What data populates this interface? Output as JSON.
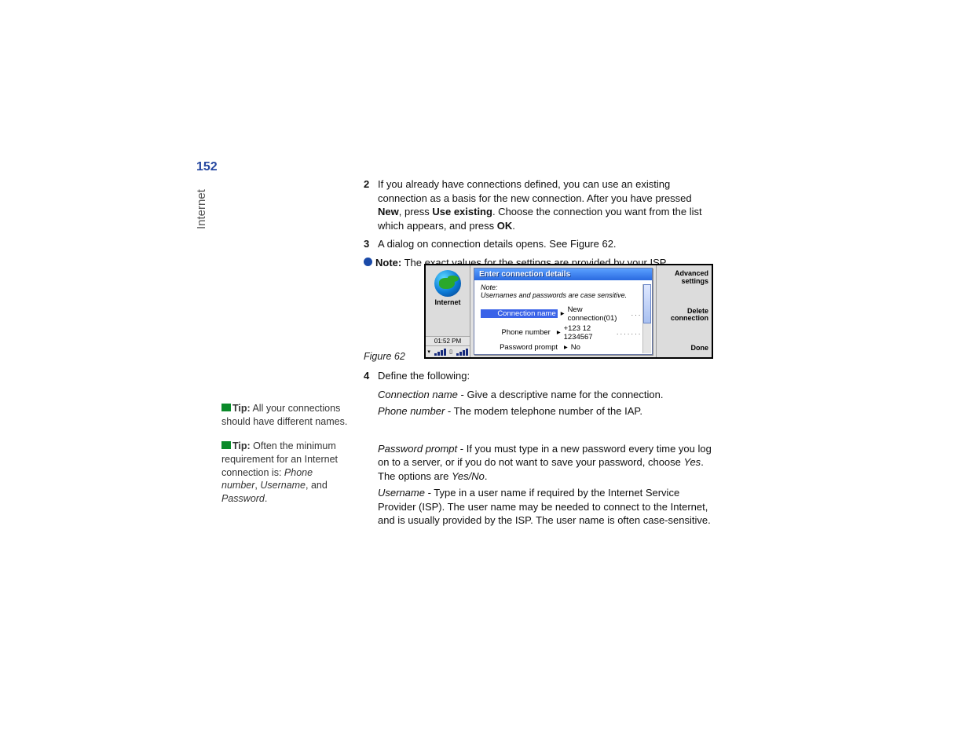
{
  "page_number": "152",
  "side_label": "Internet",
  "tips": [
    {
      "label": "Tip:",
      "text_before": " All your connections should have different names."
    },
    {
      "label": "Tip:",
      "text_before": " Often the minimum requirement for an Internet connection is: ",
      "em1": "Phone number",
      "sep1": ", ",
      "em2": "Username",
      "sep2": ", and ",
      "em3": "Password",
      "tail": "."
    }
  ],
  "steps": {
    "s2_num": "2",
    "s2_a": "If you already have connections defined, you can use an existing connection as a basis for the new connection. After you have pressed ",
    "s2_b": "New",
    "s2_c": ", press ",
    "s2_d": "Use existing",
    "s2_e": ". Choose the connection you want from the list which appears, and press ",
    "s2_f": "OK",
    "s2_g": ".",
    "s3_num": "3",
    "s3": "A dialog on connection details opens. See Figure 62.",
    "note_label": "Note:",
    "note_text": " The exact values for the settings are provided by your ISP.",
    "s4_num": "4",
    "s4": "Define the following:"
  },
  "fig_caption": "Figure 62",
  "shot": {
    "left_label": "Internet",
    "time": "01:52 PM",
    "dlg_title": "Enter connection details",
    "dlg_note1": "Note:",
    "dlg_note2": "Usernames and passwords are case sensitive.",
    "f1_label": "Connection name",
    "f1_val": "New connection(01)",
    "f2_label": "Phone number",
    "f2_val": "+123 12 1234567",
    "f3_label": "Password prompt",
    "f3_val": "No",
    "soft1a": "Advanced",
    "soft1b": "settings",
    "soft2a": "Delete",
    "soft2b": "connection",
    "soft3": "Done"
  },
  "defs": {
    "d1_t": "Connection name",
    "d1_b": " - Give a descriptive name for the connection.",
    "d2_t": "Phone number",
    "d2_b": " - The modem telephone number of the IAP.",
    "d3_t": "Password prompt",
    "d3_a": " - If you must type in a new password every time you log on to a server, or if you do not want to save your password, choose ",
    "d3_y": "Yes",
    "d3_b": ". The options are ",
    "d3_yn": "Yes/No",
    "d3_c": ".",
    "d4_t": "Username",
    "d4_b": " - Type in a user name if required by the Internet Service Provider (ISP). The user name may be needed to connect to the Internet, and is usually provided by the ISP. The user name is often case-sensitive."
  }
}
